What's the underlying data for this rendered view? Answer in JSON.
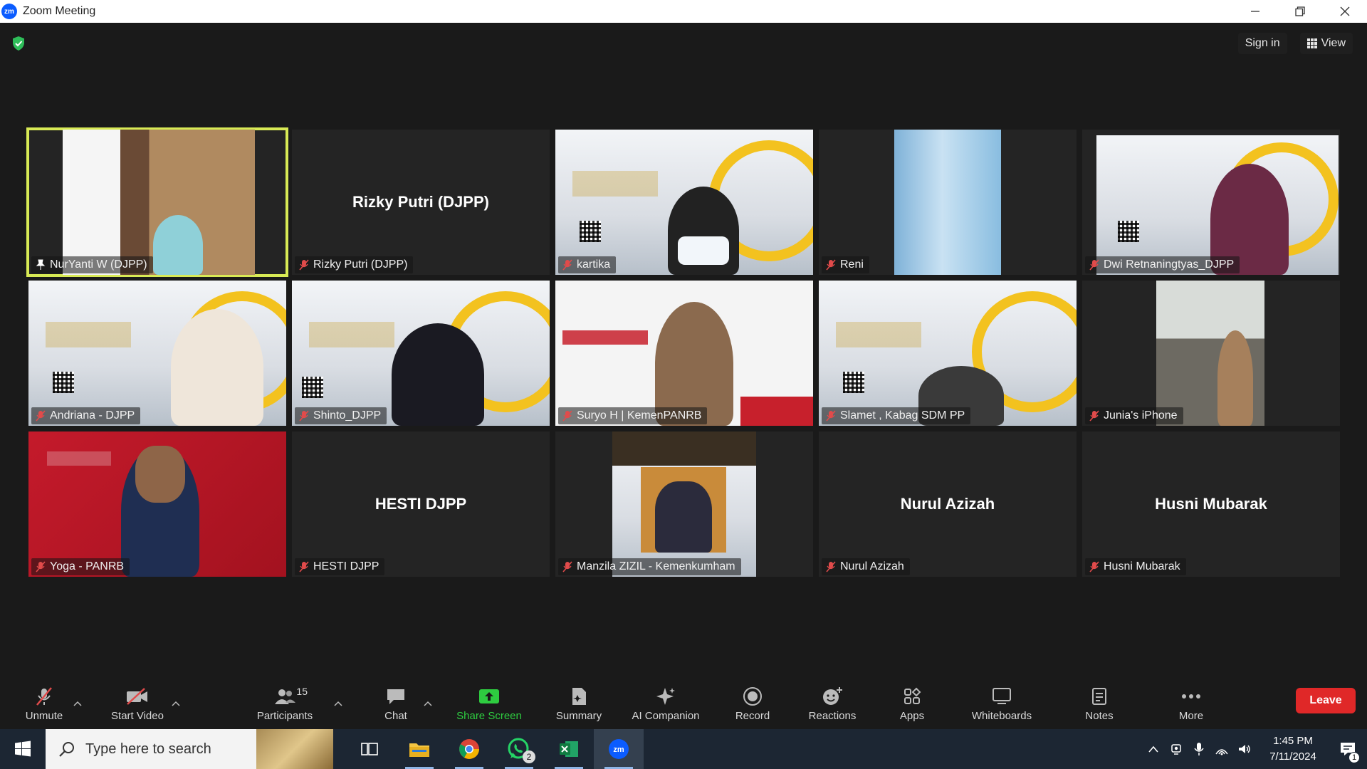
{
  "window": {
    "title": "Zoom Meeting",
    "app_logo": "zm"
  },
  "top_bar": {
    "sign_in": "Sign in",
    "view": "View"
  },
  "tiles": [
    {
      "name": "NurYanti W (DJPP)",
      "center_name": "",
      "pinned": true
    },
    {
      "name": "Rizky Putri (DJPP)",
      "center_name": "Rizky Putri (DJPP)"
    },
    {
      "name": "kartika",
      "center_name": ""
    },
    {
      "name": "Reni",
      "center_name": ""
    },
    {
      "name": "Dwi Retnaningtyas_DJPP",
      "center_name": ""
    },
    {
      "name": "Andriana - DJPP",
      "center_name": ""
    },
    {
      "name": "Shinto_DJPP",
      "center_name": ""
    },
    {
      "name": "Suryo H | KemenPANRB",
      "center_name": ""
    },
    {
      "name": "Slamet , Kabag SDM PP",
      "center_name": ""
    },
    {
      "name": "Junia's iPhone",
      "center_name": ""
    },
    {
      "name": "Yoga - PANRB",
      "center_name": ""
    },
    {
      "name": "HESTI DJPP",
      "center_name": "HESTI DJPP"
    },
    {
      "name": "Manzila ZIZIL - Kemenkumham",
      "center_name": ""
    },
    {
      "name": "Nurul Azizah",
      "center_name": "Nurul Azizah"
    },
    {
      "name": "Husni Mubarak",
      "center_name": "Husni Mubarak"
    }
  ],
  "toolbar": {
    "unmute": "Unmute",
    "start_video": "Start Video",
    "participants": "Participants",
    "participants_count": "15",
    "chat": "Chat",
    "share_screen": "Share Screen",
    "summary": "Summary",
    "ai_companion": "AI Companion",
    "record": "Record",
    "reactions": "Reactions",
    "apps": "Apps",
    "whiteboards": "Whiteboards",
    "notes": "Notes",
    "more": "More",
    "leave": "Leave"
  },
  "taskbar": {
    "search_placeholder": "Type here to search",
    "whatsapp_badge": "2",
    "time": "1:45 PM",
    "date": "7/11/2024",
    "notifications_count": "1"
  },
  "colors": {
    "active_speaker": "#d8ea55",
    "leave": "#e02828",
    "share": "#2ecc40"
  }
}
